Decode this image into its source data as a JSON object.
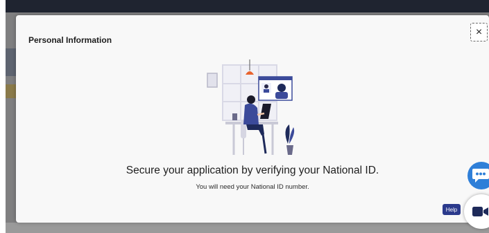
{
  "modal": {
    "title": "Personal Information",
    "close_label": "×",
    "headline": "Secure your application by verifying your National ID.",
    "subline": "You will need your National ID number."
  },
  "widgets": {
    "help_label": "Help",
    "chat_icon": "chat-bubble-icon",
    "video_icon": "video-camera-icon"
  },
  "colors": {
    "accent": "#2f7fd8",
    "help_badge": "#2b3a8c",
    "illustration_primary": "#3b4a9a",
    "illustration_accent": "#e8632e"
  }
}
